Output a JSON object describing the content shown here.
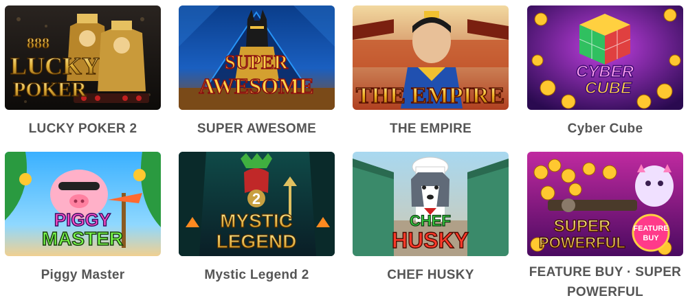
{
  "games": [
    {
      "title": "LUCKY POKER 2",
      "art_text": [
        "888",
        "LUCKY",
        "POKER"
      ]
    },
    {
      "title": "SUPER AWESOME",
      "art_text": [
        "SUPER",
        "AWESOME"
      ]
    },
    {
      "title": "THE EMPIRE",
      "art_text": [
        "THE EMPIRE"
      ]
    },
    {
      "title": "Cyber Cube",
      "art_text": [
        "CYBER",
        "CUBE"
      ]
    },
    {
      "title": "Piggy Master",
      "art_text": [
        "PIGGY",
        "MASTER"
      ]
    },
    {
      "title": "Mystic Legend 2",
      "art_text": [
        "2",
        "MYSTIC",
        "LEGEND"
      ]
    },
    {
      "title": "CHEF HUSKY",
      "art_text": [
        "CHEF",
        "HUSKY"
      ]
    },
    {
      "title": "FEATURE BUY · SUPER POWERFUL",
      "art_text": [
        "SUPER",
        "POWERFUL",
        "FEATURE",
        "BUY"
      ]
    }
  ],
  "colors": {
    "title_text": "#555555",
    "background": "#ffffff"
  }
}
